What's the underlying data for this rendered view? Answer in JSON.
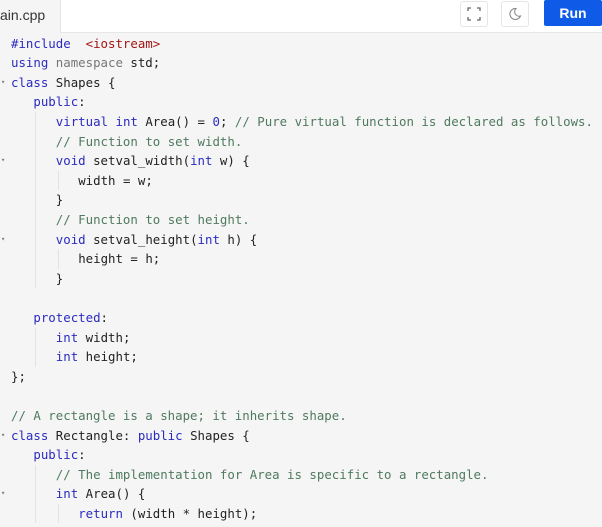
{
  "header": {
    "tab_label": "ain.cpp",
    "fullscreen_icon": "fullscreen-icon",
    "theme_icon": "moon-icon",
    "run_label": "Run",
    "run_color": "#0f5ae6"
  },
  "code": {
    "lines": [
      {
        "indent": 0,
        "fold": false,
        "tokens": [
          [
            "kw",
            "#include"
          ],
          [
            "",
            "  "
          ],
          [
            "str",
            "<iostream>"
          ]
        ]
      },
      {
        "indent": 0,
        "fold": false,
        "tokens": [
          [
            "kw",
            "using"
          ],
          [
            "",
            " "
          ],
          [
            "ns",
            "namespace"
          ],
          [
            "",
            " std;"
          ]
        ]
      },
      {
        "indent": 0,
        "fold": true,
        "tokens": [
          [
            "kw",
            "class"
          ],
          [
            "",
            " Shapes {"
          ]
        ]
      },
      {
        "indent": 1,
        "fold": false,
        "tokens": [
          [
            "kw",
            "public"
          ],
          [
            "",
            ":"
          ]
        ]
      },
      {
        "indent": 2,
        "fold": false,
        "tokens": [
          [
            "kw",
            "virtual"
          ],
          [
            "",
            " "
          ],
          [
            "kw",
            "int"
          ],
          [
            "",
            " Area() = "
          ],
          [
            "kw",
            "0"
          ],
          [
            "",
            ";"
          ],
          [
            "",
            " "
          ],
          [
            "cm",
            "// Pure virtual function is declared as follows."
          ]
        ]
      },
      {
        "indent": 2,
        "fold": false,
        "tokens": [
          [
            "cm",
            "// Function to set width."
          ]
        ]
      },
      {
        "indent": 2,
        "fold": true,
        "tokens": [
          [
            "kw",
            "void"
          ],
          [
            "",
            " setval_width("
          ],
          [
            "kw",
            "int"
          ],
          [
            "",
            " w) {"
          ]
        ]
      },
      {
        "indent": 3,
        "fold": false,
        "tokens": [
          [
            "",
            "width = w;"
          ]
        ]
      },
      {
        "indent": 2,
        "fold": false,
        "tokens": [
          [
            "",
            "}"
          ]
        ]
      },
      {
        "indent": 2,
        "fold": false,
        "tokens": [
          [
            "cm",
            "// Function to set height."
          ]
        ]
      },
      {
        "indent": 2,
        "fold": true,
        "tokens": [
          [
            "kw",
            "void"
          ],
          [
            "",
            " setval_height("
          ],
          [
            "kw",
            "int"
          ],
          [
            "",
            " h) {"
          ]
        ]
      },
      {
        "indent": 3,
        "fold": false,
        "tokens": [
          [
            "",
            "height = h;"
          ]
        ]
      },
      {
        "indent": 2,
        "fold": false,
        "tokens": [
          [
            "",
            "}"
          ]
        ]
      },
      {
        "indent": 0,
        "fold": false,
        "tokens": []
      },
      {
        "indent": 1,
        "fold": false,
        "tokens": [
          [
            "kw",
            "protected"
          ],
          [
            "",
            ":"
          ]
        ]
      },
      {
        "indent": 2,
        "fold": false,
        "tokens": [
          [
            "kw",
            "int"
          ],
          [
            "",
            " width;"
          ]
        ]
      },
      {
        "indent": 2,
        "fold": false,
        "tokens": [
          [
            "kw",
            "int"
          ],
          [
            "",
            " height;"
          ]
        ]
      },
      {
        "indent": 0,
        "fold": false,
        "tokens": [
          [
            "",
            "};"
          ]
        ]
      },
      {
        "indent": 0,
        "fold": false,
        "tokens": []
      },
      {
        "indent": 0,
        "fold": false,
        "tokens": [
          [
            "cm",
            "// A rectangle is a shape; it inherits shape."
          ]
        ]
      },
      {
        "indent": 0,
        "fold": true,
        "tokens": [
          [
            "kw",
            "class"
          ],
          [
            "",
            " Rectangle: "
          ],
          [
            "kw",
            "public"
          ],
          [
            "",
            " Shapes {"
          ]
        ]
      },
      {
        "indent": 1,
        "fold": false,
        "tokens": [
          [
            "kw",
            "public"
          ],
          [
            "",
            ":"
          ]
        ]
      },
      {
        "indent": 2,
        "fold": false,
        "tokens": [
          [
            "cm",
            "// The implementation for Area is specific to a rectangle."
          ]
        ]
      },
      {
        "indent": 2,
        "fold": true,
        "tokens": [
          [
            "kw",
            "int"
          ],
          [
            "",
            " Area() {"
          ]
        ]
      },
      {
        "indent": 3,
        "fold": false,
        "tokens": [
          [
            "kw",
            "return"
          ],
          [
            "",
            " (width * height);"
          ]
        ]
      }
    ]
  }
}
